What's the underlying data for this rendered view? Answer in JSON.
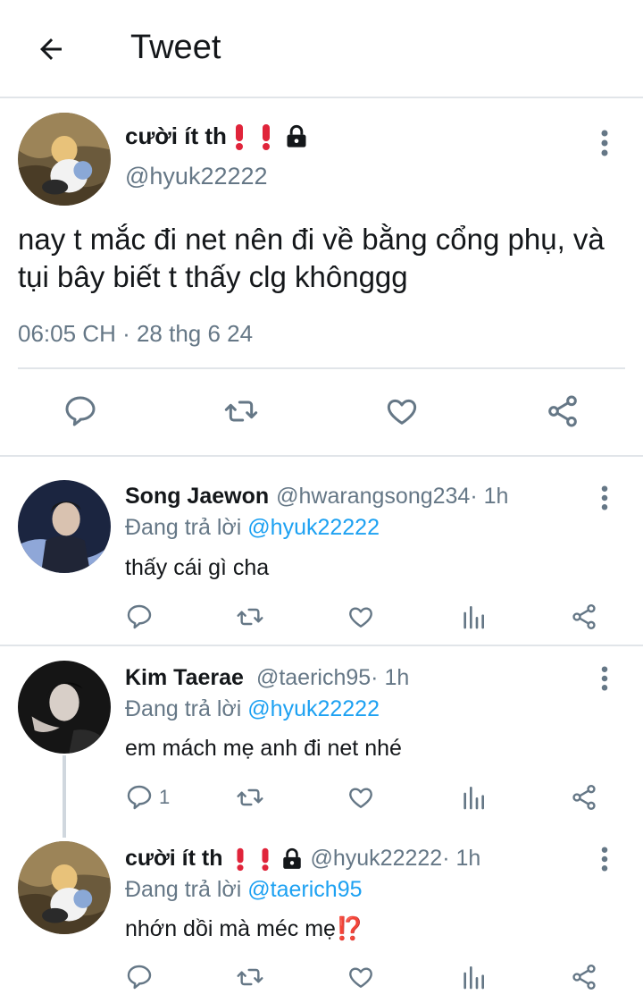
{
  "header": {
    "title": "Tweet",
    "back_icon": "arrow-left-icon"
  },
  "main_tweet": {
    "name": "cười ít th",
    "handle": "@hyuk22222",
    "text": "nay t mắc đi net nên đi về bằng cổng phụ, và tụi bây biết t thấy clg khônggg",
    "meta": "06:05 CH · 28 thg 6 24",
    "badges": [
      "exclamation-icon",
      "exclamation-icon",
      "lock-icon"
    ]
  },
  "replies": [
    {
      "name": "Song Jaewon",
      "handle": "@hwarangsong234",
      "time": " · 1h",
      "replying_prefix": "Đang trả lời ",
      "replying_to": "@hyuk22222",
      "text": "thấy cái gì cha",
      "reply_count": ""
    },
    {
      "name": "Kim Taerae",
      "handle": "@taerich95",
      "time": " · 1h",
      "replying_prefix": "Đang trả lời ",
      "replying_to": "@hyuk22222",
      "text": "em mách mẹ anh đi net nhé",
      "reply_count": "1"
    },
    {
      "name": "cười ít th",
      "handle": "@hyuk22222",
      "time": " · 1h",
      "replying_prefix": "Đang trả lời ",
      "replying_to": "@taerich95",
      "text": "nhớn dồi mà méc mẹ",
      "text_emoji": "⁉️",
      "reply_count": ""
    }
  ],
  "colors": {
    "text": "#14171a",
    "secondary": "#657786",
    "mention": "#1da1f2",
    "divider": "#e1e5e9",
    "exclamation": "#e0243a"
  }
}
